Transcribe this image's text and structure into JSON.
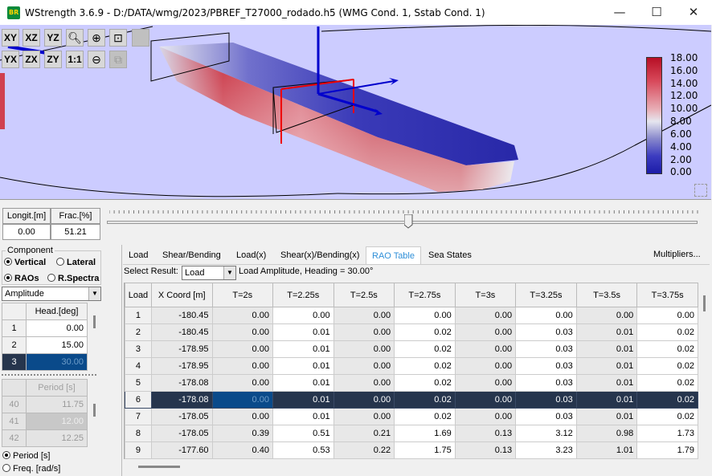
{
  "window": {
    "app_logo_text": "BR",
    "title": "WStrength 3.6.9 - D:/DATA/wmg/2023/PBREF_T27000_rodado.h5 (WMG Cond. 1, Sstab Cond. 1)",
    "minimize": "—",
    "maximize": "☐",
    "close": "✕"
  },
  "viewport": {
    "toolbar_row1": [
      "XY",
      "XZ",
      "YZ"
    ],
    "toolbar_row2": [
      "YX",
      "ZX",
      "ZY",
      "1:1"
    ],
    "icons": [
      "search-icon",
      "zoom-in-icon",
      "fit-view-icon",
      "color-square-icon",
      "zoom-out-icon",
      "copy-view-icon"
    ],
    "colorbar_labels": [
      "18.00",
      "16.00",
      "14.00",
      "12.00",
      "10.00",
      "8.00",
      "6.00",
      "4.00",
      "2.00",
      "0.00"
    ],
    "colors": {
      "background": "#ccccff",
      "hot": "#b70f25",
      "cold": "#1c1ca8"
    }
  },
  "position": {
    "longit_label": "Longit.[m]",
    "frac_label": "Frac.[%]",
    "longit_value": "0.00",
    "frac_value": "51.21",
    "slider_fraction": 0.51
  },
  "left_panel": {
    "component_label": "Component",
    "vertical_label": "Vertical",
    "lateral_label": "Lateral",
    "raos_label": "RAOs",
    "rspectra_label": "R.Spectra",
    "mode_select": "Amplitude",
    "heading_header": "Head.[deg]",
    "headings": [
      {
        "idx": "1",
        "value": "0.00"
      },
      {
        "idx": "2",
        "value": "15.00"
      },
      {
        "idx": "3",
        "value": "30.00"
      }
    ],
    "period_header": "Period [s]",
    "periods": [
      {
        "idx": "40",
        "value": "11.75"
      },
      {
        "idx": "41",
        "value": "12.00"
      },
      {
        "idx": "42",
        "value": "12.25"
      }
    ],
    "period_radio": "Period [s]",
    "freq_radio": "Freq. [rad/s]"
  },
  "tabs": [
    "Load",
    "Shear/Bending",
    "Load(x)",
    "Shear(x)/Bending(x)",
    "RAO Table",
    "Sea States"
  ],
  "active_tab": "RAO Table",
  "multipliers_label": "Multipliers...",
  "result": {
    "label": "Select Result:",
    "selected": "Load",
    "caption": "Load Amplitude, Heading = 30.00°"
  },
  "table": {
    "columns": [
      "Load",
      "X Coord [m]",
      "T=2s",
      "T=2.25s",
      "T=2.5s",
      "T=2.75s",
      "T=3s",
      "T=3.25s",
      "T=3.5s",
      "T=3.75s"
    ],
    "rows": [
      [
        "1",
        "-180.45",
        "0.00",
        "0.00",
        "0.00",
        "0.00",
        "0.00",
        "0.00",
        "0.00",
        "0.00"
      ],
      [
        "2",
        "-180.45",
        "0.00",
        "0.01",
        "0.00",
        "0.02",
        "0.00",
        "0.03",
        "0.01",
        "0.02"
      ],
      [
        "3",
        "-178.95",
        "0.00",
        "0.01",
        "0.00",
        "0.02",
        "0.00",
        "0.03",
        "0.01",
        "0.02"
      ],
      [
        "4",
        "-178.95",
        "0.00",
        "0.01",
        "0.00",
        "0.02",
        "0.00",
        "0.03",
        "0.01",
        "0.02"
      ],
      [
        "5",
        "-178.08",
        "0.00",
        "0.01",
        "0.00",
        "0.02",
        "0.00",
        "0.03",
        "0.01",
        "0.02"
      ],
      [
        "6",
        "-178.08",
        "0.00",
        "0.01",
        "0.00",
        "0.02",
        "0.00",
        "0.03",
        "0.01",
        "0.02"
      ],
      [
        "7",
        "-178.05",
        "0.00",
        "0.01",
        "0.00",
        "0.02",
        "0.00",
        "0.03",
        "0.01",
        "0.02"
      ],
      [
        "8",
        "-178.05",
        "0.39",
        "0.51",
        "0.21",
        "1.69",
        "0.13",
        "3.12",
        "0.98",
        "1.73"
      ],
      [
        "9",
        "-177.60",
        "0.40",
        "0.53",
        "0.22",
        "1.75",
        "0.13",
        "3.23",
        "1.01",
        "1.79"
      ]
    ],
    "selected_row": "6"
  }
}
